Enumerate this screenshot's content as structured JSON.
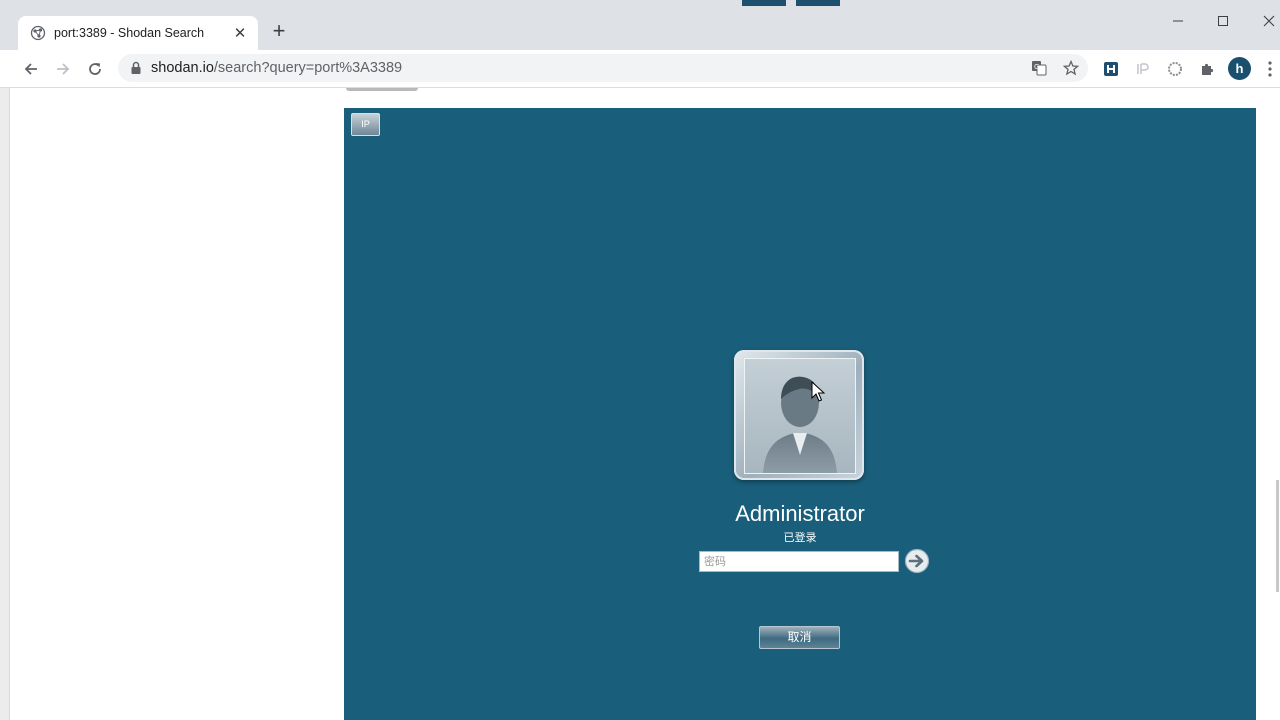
{
  "browser": {
    "tab": {
      "title": "port:3389 - Shodan Search",
      "close_glyph": "✕",
      "favicon": "shodan-icon"
    },
    "new_tab_glyph": "+",
    "url": {
      "host": "shodan.io",
      "path": "/search?query=port%3A3389"
    },
    "omnibox_icons": [
      "translate-icon",
      "star-icon"
    ],
    "extensions": [
      "h-extension-icon",
      "ip-extension-icon",
      "circle-extension-icon",
      "puzzle-icon"
    ],
    "profile_initial": "h",
    "window_controls": [
      "minimize-icon",
      "maximize-icon",
      "close-icon"
    ]
  },
  "rdp": {
    "corner_button": "IP",
    "username": "Administrator",
    "status": "已登录",
    "password_placeholder": "密码",
    "cancel_label": "取消"
  },
  "colors": {
    "rdp_background": "#195e7b",
    "titlebar": "#dee1e6",
    "avatar": "#1a4f6e"
  }
}
